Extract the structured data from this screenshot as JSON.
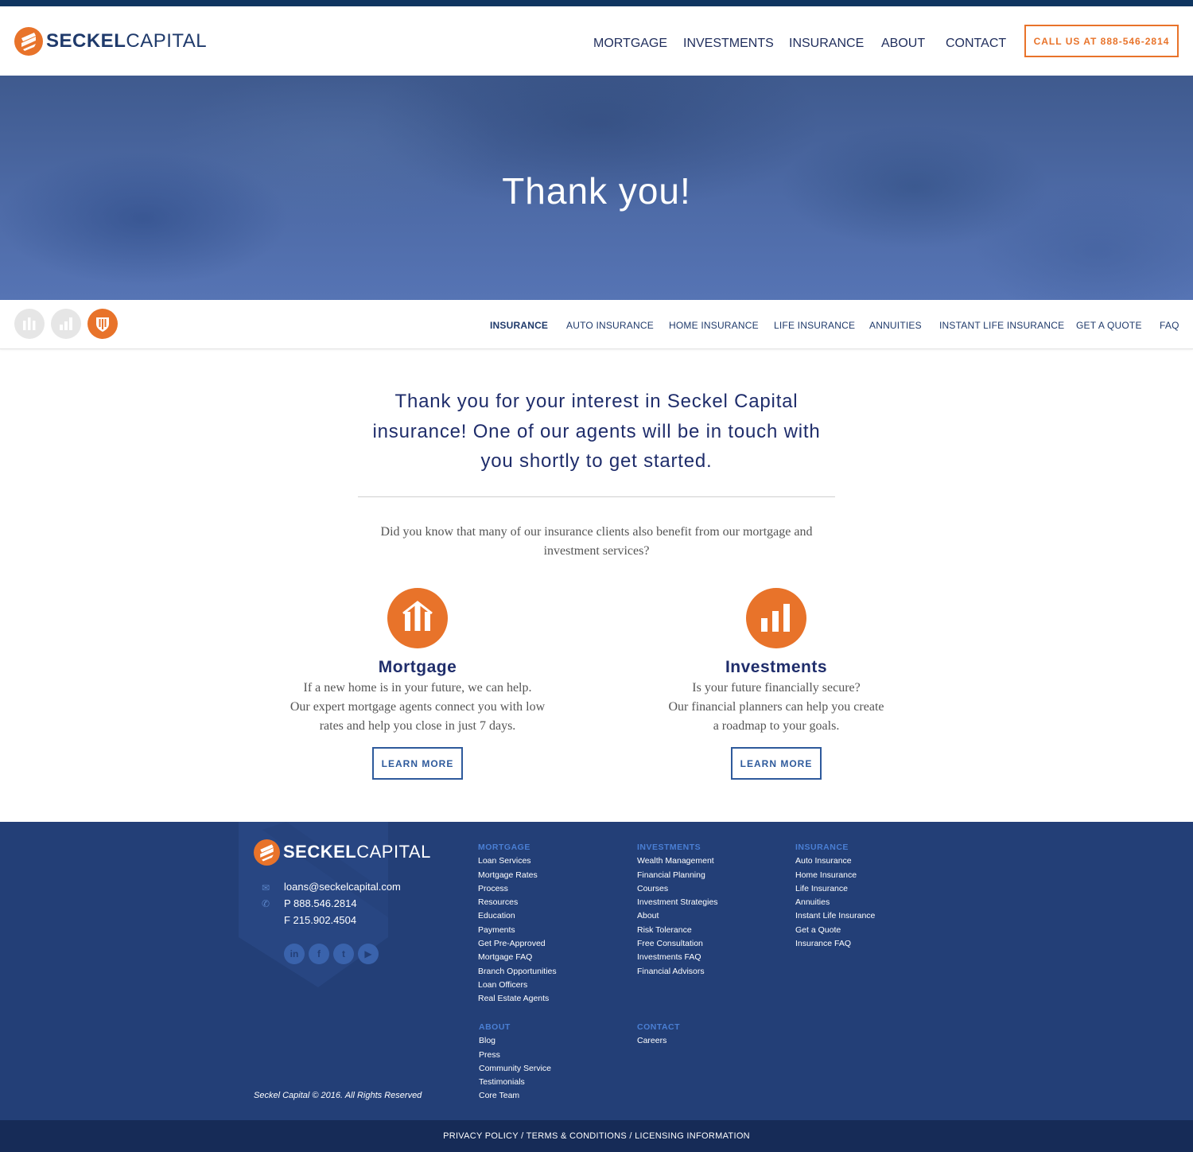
{
  "brand": {
    "name_bold": "SECKEL",
    "name_light": "CAPITAL",
    "accent_color": "#e8732a",
    "navy_color": "#1f3a6b"
  },
  "header": {
    "nav": [
      "MORTGAGE",
      "INVESTMENTS",
      "INSURANCE",
      "ABOUT",
      "CONTACT"
    ],
    "call_button": "CALL US AT 888-546-2814"
  },
  "hero": {
    "title": "Thank you!"
  },
  "subnav": {
    "icons": [
      "mortgage-icon",
      "investments-icon",
      "insurance-icon"
    ],
    "active_icon": "insurance-icon",
    "links": [
      "INSURANCE",
      "AUTO INSURANCE",
      "HOME INSURANCE",
      "LIFE INSURANCE",
      "ANNUITIES",
      "INSTANT LIFE INSURANCE",
      "GET A QUOTE",
      "FAQ"
    ],
    "current": "INSURANCE"
  },
  "main": {
    "intro": "Thank you for your interest in Seckel Capital insurance! One of our agents will be in touch with you shortly to get started.",
    "did_you_know": "Did you know that many of our insurance clients also benefit from our mortgage and investment services?",
    "services": [
      {
        "title": "Mortgage",
        "icon": "mortgage-icon",
        "lines": [
          "If a new home is in your future, we can help.",
          "Our expert mortgage agents connect you with low",
          "rates and help you close in just 7 days."
        ],
        "button": "LEARN MORE"
      },
      {
        "title": "Investments",
        "icon": "investments-icon",
        "lines": [
          "Is your future financially secure?",
          "Our financial planners can help you create",
          "a roadmap to your goals."
        ],
        "button": "LEARN MORE"
      }
    ]
  },
  "footer": {
    "email": "loans@seckelcapital.com",
    "phone": "P 888.546.2814",
    "fax": "F 215.902.4504",
    "social": [
      "linkedin-icon",
      "facebook-icon",
      "twitter-icon",
      "youtube-icon"
    ],
    "social_glyphs": [
      "in",
      "f",
      "t",
      "▶"
    ],
    "columns": {
      "mortgage": {
        "head": "MORTGAGE",
        "items": [
          "Loan Services",
          "Mortgage Rates",
          "Process",
          "Resources",
          "Education",
          "Payments",
          "Get Pre-Approved",
          "Mortgage FAQ",
          "Branch Opportunities",
          "Loan Officers",
          "Real Estate Agents"
        ]
      },
      "investments": {
        "head": "INVESTMENTS",
        "items": [
          "Wealth Management",
          "Financial Planning",
          "Courses",
          "Investment Strategies",
          "About",
          "Risk Tolerance",
          "Free Consultation",
          "Investments FAQ",
          "Financial Advisors"
        ]
      },
      "insurance": {
        "head": "INSURANCE",
        "items": [
          "Auto Insurance",
          "Home Insurance",
          "Life Insurance",
          "Annuities",
          "Instant Life Insurance",
          "Get a Quote",
          "Insurance FAQ"
        ]
      },
      "about": {
        "head": "ABOUT",
        "items": [
          "Blog",
          "Press",
          "Community Service",
          "Testimonials",
          "Core Team"
        ]
      },
      "contact": {
        "head": "CONTACT",
        "items": [
          "Careers"
        ]
      }
    },
    "copyright": "Seckel Capital © 2016. All Rights Reserved",
    "legal": "PRIVACY POLICY / TERMS & CONDITIONS / LICENSING INFORMATION"
  }
}
